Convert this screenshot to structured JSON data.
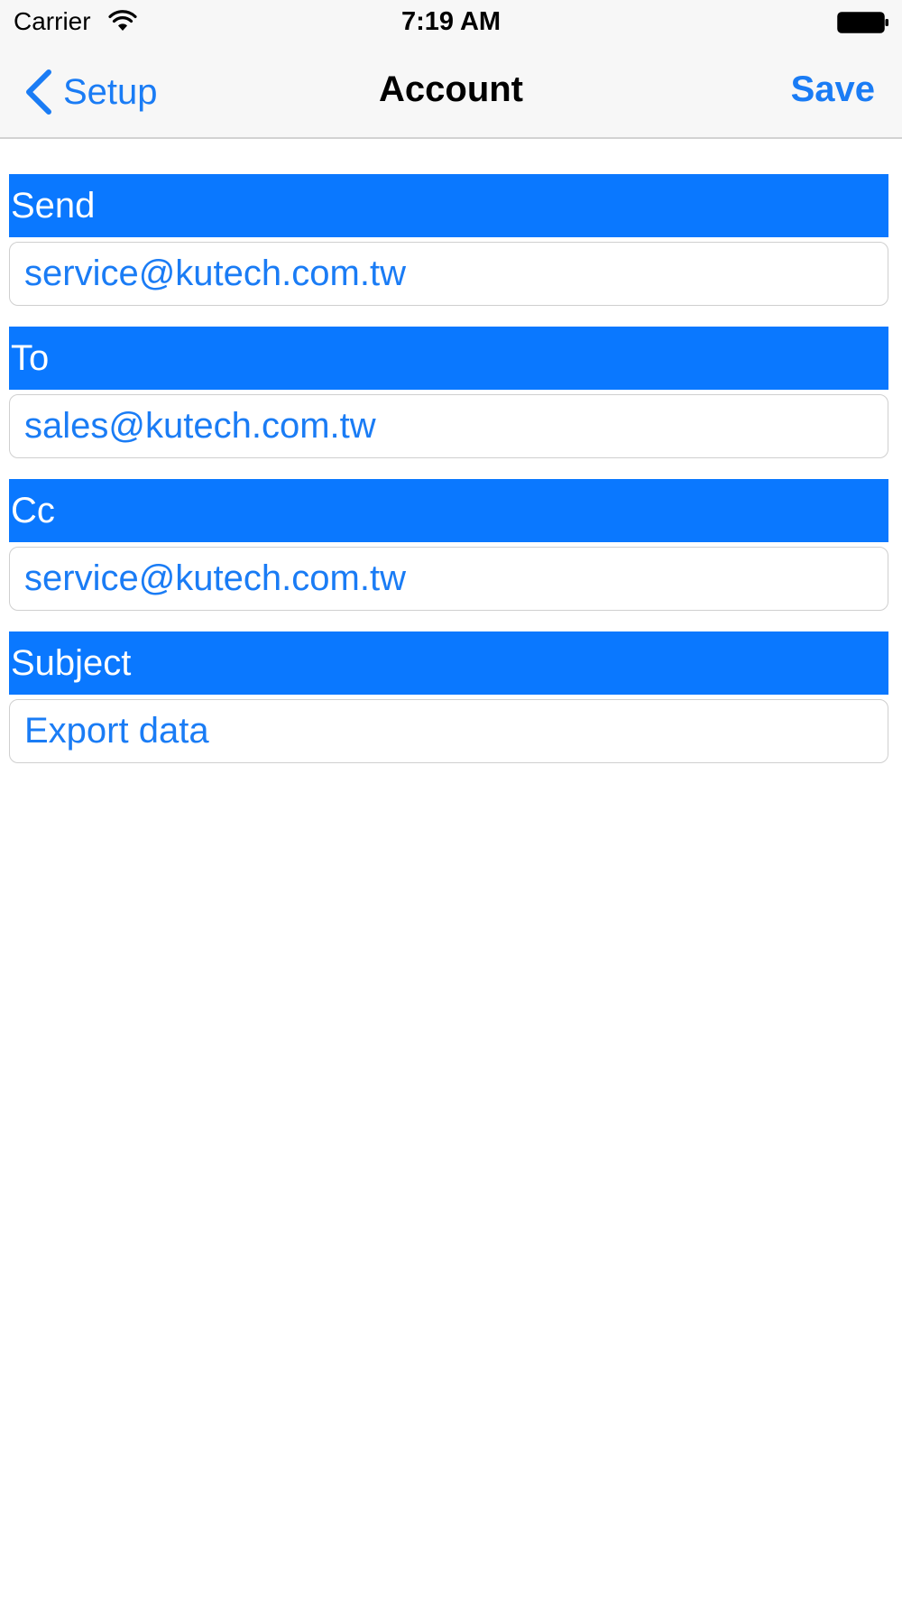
{
  "status_bar": {
    "carrier": "Carrier",
    "time": "7:19 AM",
    "wifi_icon": "wifi-icon",
    "battery_icon": "battery-icon"
  },
  "nav": {
    "back_label": "Setup",
    "back_icon": "chevron-left-icon",
    "title": "Account",
    "save_label": "Save"
  },
  "form": {
    "send": {
      "label": "Send",
      "value": "service@kutech.com.tw"
    },
    "to": {
      "label": "To",
      "value": "sales@kutech.com.tw"
    },
    "cc": {
      "label": "Cc",
      "value": "service@kutech.com.tw"
    },
    "subject": {
      "label": "Subject",
      "value": "Export data"
    }
  },
  "colors": {
    "accent": "#1a7cf5",
    "header_bg": "#0a78ff",
    "nav_bg": "#f7f7f7"
  }
}
